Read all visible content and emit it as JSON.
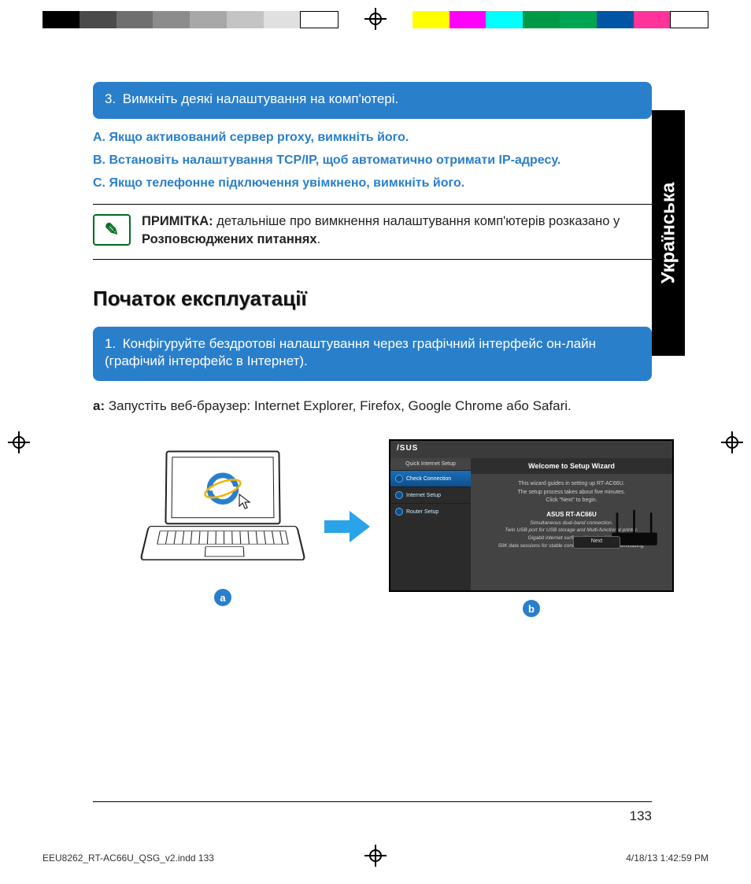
{
  "topbar_colors": [
    "#000000",
    "#4a4a4a",
    "#6f6f6f",
    "#8c8c8c",
    "#a8a8a8",
    "#c4c4c4",
    "#e0e0e0",
    "#ffffff",
    "gap",
    "#ffff00",
    "#ff00ff",
    "#00ffff",
    "#009a46",
    "#00a552",
    "#0055a5",
    "#ff3399",
    "#ffffff"
  ],
  "language_tab": "Українська",
  "step3": {
    "num": "3.",
    "text": "Вимкніть деякі налаштування на комп'ютері."
  },
  "sublist": {
    "a": "A.   Якщо активований сервер proxy, вимкніть його.",
    "b": "B.   Встановіть налаштування TCP/IP, щоб автоматично отримати IP-адресу.",
    "c": "C. Якщо телефонне підключення увімкнено, вимкніть його."
  },
  "note": {
    "icon_glyph": "✎",
    "label": "ПРИМІТКА:",
    "text_before": "  детальніше про вимкнення налаштування комп'ютерів розказано у ",
    "bold": "Розповсюджених питаннях",
    "text_after": "."
  },
  "section_heading": "Початок експлуатації",
  "step1": {
    "num": "1.",
    "text": "Конфігуруйте бездротові налаштування через графічний інтерфейс он-лайн (графічий інтерфейс в Інтернет)."
  },
  "step_a": {
    "label": "a:",
    "text": "  Запустіть веб-браузер: Internet Explorer, Firefox, Google Chrome або  Safari."
  },
  "labels": {
    "a": "a",
    "b": "b"
  },
  "wizard": {
    "brand": "/SUS",
    "sidebar_header": "Quick Internet Setup",
    "sidebar_items": [
      "Check Connection",
      "Internet Setup",
      "Router Setup"
    ],
    "title": "Welcome to Setup Wizard",
    "line1": "This wizard guides in setting up RT-AC66U.",
    "line2": "The setup process takes about five minutes.",
    "line3": "Click \"Next\" to begin.",
    "model": "ASUS RT-AC66U",
    "desc1": "Simultaneous dual-band connection.",
    "desc2": "Twin USB port for USB storage and Multi-functional printer.",
    "desc3": "Gigabit internet surfing with turbo NAT.",
    "desc4": "50K data sessions for stable connection when P2P downloading.",
    "next": "Next"
  },
  "page_number": "133",
  "footer": {
    "filename": "EEU8262_RT-AC66U_QSG_v2.indd   133",
    "datetime": "4/18/13   1:42:59 PM"
  }
}
